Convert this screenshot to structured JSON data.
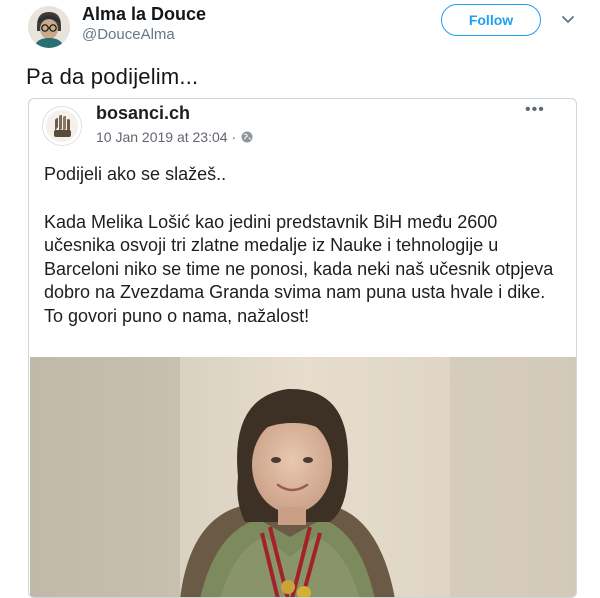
{
  "tweet": {
    "display_name": "Alma la Douce",
    "handle": "@DouceAlma",
    "follow_label": "Follow",
    "text": "Pa da podijelim..."
  },
  "embed": {
    "page_name": "bosanci.ch",
    "timestamp": "10 Jan 2019 at 23:04 ·",
    "more_label": "•••",
    "body": {
      "line_intro": "Podijeli ako se slažeš..",
      "paragraph": "Kada Melika Lošić kao jedini predstavnik BiH među 2600 učesnika osvoji tri zlatne medalje iz Nauke i tehnologije u Barceloni niko se time ne ponosi, kada neki naš učesnik otpjeva dobro na Zvezdama Granda svima nam puna usta hvale i dike.",
      "closing": "To govori puno o nama, nažalost!"
    }
  },
  "colors": {
    "accent": "#1da1f2",
    "secondary_text": "#657786",
    "card_border": "#ccd6dd"
  },
  "icons": [
    "avatar-illustration",
    "chevron-down-icon",
    "globe-icon",
    "more-options-icon",
    "page-logo"
  ]
}
